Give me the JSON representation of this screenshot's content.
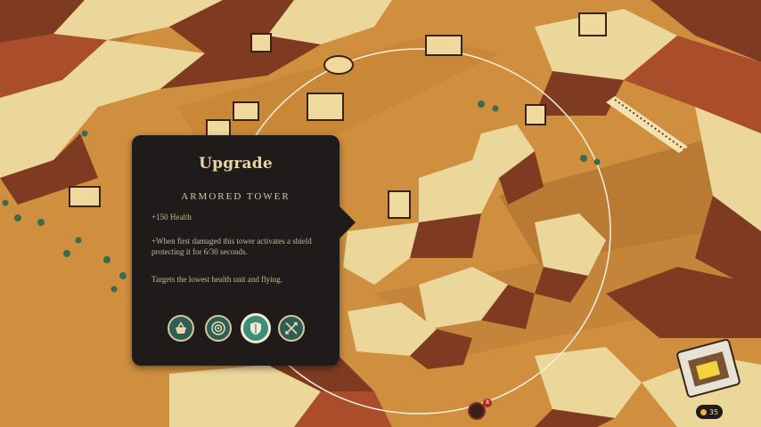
{
  "panel": {
    "title": "Upgrade",
    "tower_name": "ARMORED TOWER",
    "stats": [
      "+150 Health",
      "+When first damaged this tower activates a shield protecting it for 6/30 seconds.",
      "Targets the lowest health unit and flying."
    ],
    "upgrades": [
      {
        "icon": "basket-icon",
        "selected": false
      },
      {
        "icon": "target-icon",
        "selected": false
      },
      {
        "icon": "shield-icon",
        "selected": true
      },
      {
        "icon": "crossed-arrows-icon",
        "selected": false
      }
    ]
  },
  "hud": {
    "gold": "35",
    "enemy_count": "8"
  },
  "colors": {
    "ground": "#cf8f3e",
    "rock_light": "#ecd79a",
    "rock_dark": "#7f3b22",
    "panel": "#1f1b1a",
    "upgrade_teal": "#2e5f55",
    "selected_teal": "#3b8e7d"
  }
}
